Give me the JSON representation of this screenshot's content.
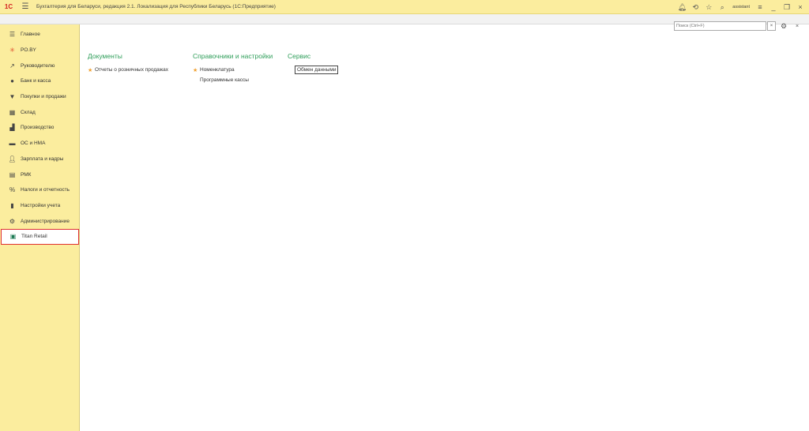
{
  "titlebar": {
    "logo": "1С",
    "title": "Бухгалтерия для Беларуси, редакция 2.1. Локализация для Республики Беларусь   (1С:Предприятие)",
    "user": "assistant"
  },
  "sidebar": {
    "items": [
      {
        "label": "Главное",
        "icon": "list-icon"
      },
      {
        "label": "PO.BY",
        "icon": "sun-icon"
      },
      {
        "label": "Руководителю",
        "icon": "trend-icon"
      },
      {
        "label": "Банк и касса",
        "icon": "bank-icon"
      },
      {
        "label": "Покупки и продажи",
        "icon": "cart-icon"
      },
      {
        "label": "Склад",
        "icon": "warehouse-icon"
      },
      {
        "label": "Производство",
        "icon": "factory-icon"
      },
      {
        "label": "ОС и НМА",
        "icon": "truck-icon"
      },
      {
        "label": "Зарплата и кадры",
        "icon": "person-icon"
      },
      {
        "label": "РМК",
        "icon": "register-icon"
      },
      {
        "label": "Налоги и отчетность",
        "icon": "percent-icon"
      },
      {
        "label": "Настройки учета",
        "icon": "book-icon"
      },
      {
        "label": "Администрирование",
        "icon": "gear-icon"
      },
      {
        "label": "Titan Retail",
        "icon": "titan-icon"
      }
    ]
  },
  "search": {
    "placeholder": "Поиск (Ctrl+F)",
    "clear": "×"
  },
  "sections": {
    "documents": {
      "title": "Документы",
      "links": [
        "Отчеты о розничных продажах"
      ]
    },
    "references": {
      "title": "Справочники и настройки",
      "links": [
        "Номенклатура",
        "Программные кассы"
      ]
    },
    "service": {
      "title": "Сервис",
      "links": [
        "Обмен данными"
      ]
    }
  },
  "colors": {
    "sidebar_bg": "#fbed9e",
    "section_title": "#2f9e5a",
    "active_border": "#e03030",
    "star": "#f0a030"
  }
}
